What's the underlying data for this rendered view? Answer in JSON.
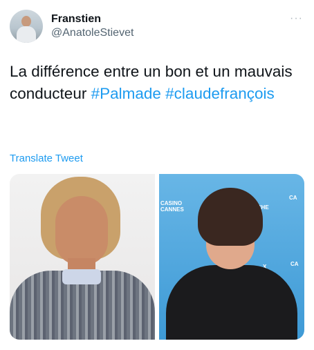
{
  "author": {
    "display_name": "Franstien",
    "handle": "@AnatoleStievet"
  },
  "more_icon": "···",
  "tweet": {
    "text": "La différence entre un bon et un mauvais conducteur ",
    "hashtag_1": "#Palmade",
    "hashtag_2": "#claudefrançois"
  },
  "translate_label": "Translate Tweet",
  "media": {
    "background_signs": {
      "casino": "CASINO",
      "cannes": "CANNES",
      "uche": "UCHE",
      "ca": "CA",
      "x": "X",
      "ca2": "CA"
    }
  },
  "colors": {
    "link": "#1d9bf0",
    "secondary_text": "#536471",
    "primary_text": "#0f1419"
  }
}
